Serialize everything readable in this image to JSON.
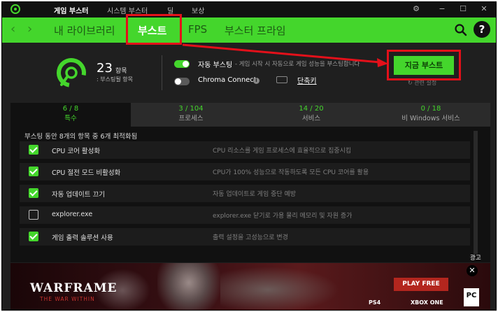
{
  "titlebar": {
    "menus": [
      "게임 부스터",
      "시스템 부스터",
      "딜",
      "보상"
    ],
    "active_menu": 0,
    "controls": {
      "settings": "⚙",
      "minimize": "−",
      "maximize": "☐",
      "close": "✕"
    }
  },
  "nav": {
    "back": "‹",
    "forward": "›",
    "tabs": [
      "내 라이브러리",
      "부스트",
      "FPS",
      "부스터 프라임"
    ],
    "active_tab": 1,
    "help": "?"
  },
  "summary": {
    "count": "23",
    "count_unit": "항목",
    "count_sub": ": 부스팅될 항목",
    "auto_boost_label": "자동 부스팅",
    "auto_boost_desc": "- 게임 시작 시 자동으로 게임 성능을 부스팅합니다",
    "auto_boost_on": true,
    "chroma_label": "Chroma Connect",
    "chroma_on": false,
    "hotkey_label": "단축키",
    "boost_button": "지금 부스트",
    "settings_link": "관련 설정"
  },
  "categories": [
    {
      "count": "6 / 8",
      "name": "특수"
    },
    {
      "count": "3 / 104",
      "name": "프로세스"
    },
    {
      "count": "14 / 20",
      "name": "서비스"
    },
    {
      "count": "0 / 18",
      "name": "비 Windows 서비스"
    }
  ],
  "list": {
    "title": "부스팅 동안 8개의 항목 중 6개 최적화됨",
    "rows": [
      {
        "name": "CPU 코어 활성화",
        "desc": "CPU 리소스를 게임 프로세스에 효율적으로 집중시킴",
        "checked": true
      },
      {
        "name": "CPU 절전 모드 비활성화",
        "desc": "CPU가 100% 성능으로 작동하도록 모든 CPU 코어를 활용",
        "checked": true
      },
      {
        "name": "자동 업데이트 끄기",
        "desc": "자동 업데이트로 게임 중단 예방",
        "checked": true
      },
      {
        "name": "explorer.exe",
        "desc": "explorer.exe 닫기로 가용 물리 메모리 및 자원 증가",
        "checked": false
      },
      {
        "name": "게임 출력 솔루션 사용",
        "desc": "출력 설정을 고성능으로 변경",
        "checked": true
      }
    ]
  },
  "ad": {
    "label": "광고",
    "close": "✕",
    "logo": "WARFRAME",
    "tagline": "THE WAR WITHIN",
    "play_button": "PLAY FREE",
    "platforms": [
      "PS4",
      "XBOX ONE"
    ],
    "pc_badge": "PC"
  },
  "colors": {
    "accent": "#44d62c",
    "highlight": "#e3101a",
    "background": "#1f1f1f"
  }
}
